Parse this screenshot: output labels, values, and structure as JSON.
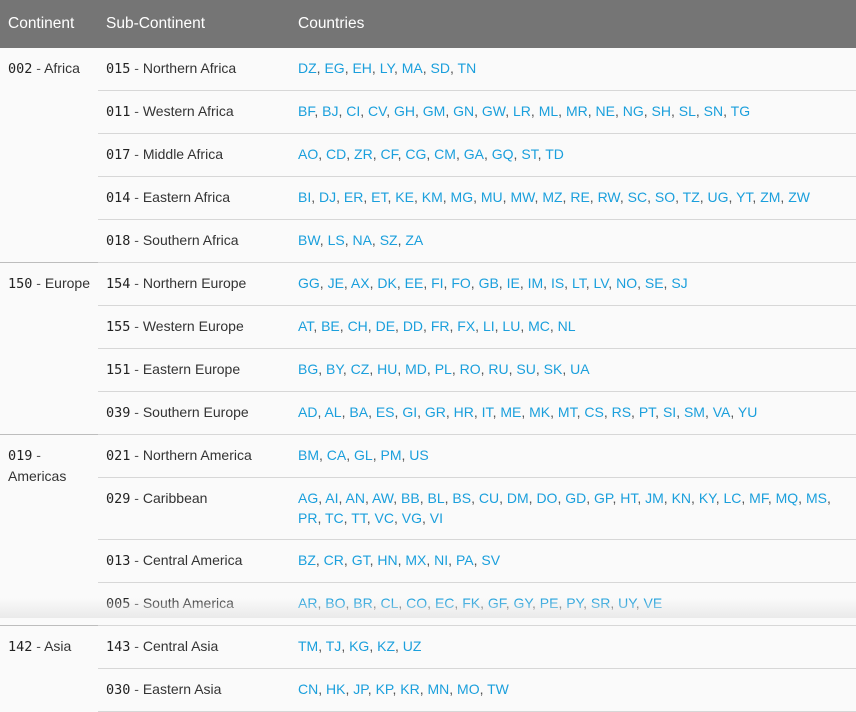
{
  "headers": {
    "continent": "Continent",
    "sub_continent": "Sub-Continent",
    "countries": "Countries"
  },
  "groups": [
    {
      "code": "002",
      "name": "Africa",
      "subs": [
        {
          "code": "015",
          "name": "Northern Africa",
          "countries": [
            "DZ",
            "EG",
            "EH",
            "LY",
            "MA",
            "SD",
            "TN"
          ]
        },
        {
          "code": "011",
          "name": "Western Africa",
          "countries": [
            "BF",
            "BJ",
            "CI",
            "CV",
            "GH",
            "GM",
            "GN",
            "GW",
            "LR",
            "ML",
            "MR",
            "NE",
            "NG",
            "SH",
            "SL",
            "SN",
            "TG"
          ]
        },
        {
          "code": "017",
          "name": "Middle Africa",
          "countries": [
            "AO",
            "CD",
            "ZR",
            "CF",
            "CG",
            "CM",
            "GA",
            "GQ",
            "ST",
            "TD"
          ]
        },
        {
          "code": "014",
          "name": "Eastern Africa",
          "countries": [
            "BI",
            "DJ",
            "ER",
            "ET",
            "KE",
            "KM",
            "MG",
            "MU",
            "MW",
            "MZ",
            "RE",
            "RW",
            "SC",
            "SO",
            "TZ",
            "UG",
            "YT",
            "ZM",
            "ZW"
          ]
        },
        {
          "code": "018",
          "name": "Southern Africa",
          "countries": [
            "BW",
            "LS",
            "NA",
            "SZ",
            "ZA"
          ]
        }
      ]
    },
    {
      "code": "150",
      "name": "Europe",
      "subs": [
        {
          "code": "154",
          "name": "Northern Europe",
          "countries": [
            "GG",
            "JE",
            "AX",
            "DK",
            "EE",
            "FI",
            "FO",
            "GB",
            "IE",
            "IM",
            "IS",
            "LT",
            "LV",
            "NO",
            "SE",
            "SJ"
          ]
        },
        {
          "code": "155",
          "name": "Western Europe",
          "countries": [
            "AT",
            "BE",
            "CH",
            "DE",
            "DD",
            "FR",
            "FX",
            "LI",
            "LU",
            "MC",
            "NL"
          ]
        },
        {
          "code": "151",
          "name": "Eastern Europe",
          "countries": [
            "BG",
            "BY",
            "CZ",
            "HU",
            "MD",
            "PL",
            "RO",
            "RU",
            "SU",
            "SK",
            "UA"
          ]
        },
        {
          "code": "039",
          "name": "Southern Europe",
          "countries": [
            "AD",
            "AL",
            "BA",
            "ES",
            "GI",
            "GR",
            "HR",
            "IT",
            "ME",
            "MK",
            "MT",
            "CS",
            "RS",
            "PT",
            "SI",
            "SM",
            "VA",
            "YU"
          ]
        }
      ]
    },
    {
      "code": "019",
      "name": "Americas",
      "subs": [
        {
          "code": "021",
          "name": "Northern America",
          "countries": [
            "BM",
            "CA",
            "GL",
            "PM",
            "US"
          ]
        },
        {
          "code": "029",
          "name": "Caribbean",
          "countries": [
            "AG",
            "AI",
            "AN",
            "AW",
            "BB",
            "BL",
            "BS",
            "CU",
            "DM",
            "DO",
            "GD",
            "GP",
            "HT",
            "JM",
            "KN",
            "KY",
            "LC",
            "MF",
            "MQ",
            "MS",
            "PR",
            "TC",
            "TT",
            "VC",
            "VG",
            "VI"
          ]
        },
        {
          "code": "013",
          "name": "Central America",
          "countries": [
            "BZ",
            "CR",
            "GT",
            "HN",
            "MX",
            "NI",
            "PA",
            "SV"
          ]
        },
        {
          "code": "005",
          "name": "South America",
          "countries": [
            "AR",
            "BO",
            "BR",
            "CL",
            "CO",
            "EC",
            "FK",
            "GF",
            "GY",
            "PE",
            "PY",
            "SR",
            "UY",
            "VE"
          ]
        }
      ]
    },
    {
      "code": "142",
      "name": "Asia",
      "subs": [
        {
          "code": "143",
          "name": "Central Asia",
          "countries": [
            "TM",
            "TJ",
            "KG",
            "KZ",
            "UZ"
          ]
        },
        {
          "code": "030",
          "name": "Eastern Asia",
          "countries": [
            "CN",
            "HK",
            "JP",
            "KP",
            "KR",
            "MN",
            "MO",
            "TW"
          ]
        }
      ]
    }
  ],
  "colors": {
    "header_bg": "#757575",
    "link": "#1a9fdc",
    "body_bg": "#fafafa"
  }
}
